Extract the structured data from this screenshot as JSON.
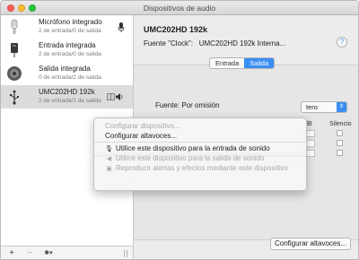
{
  "window": {
    "title": "Dispositivos de audio"
  },
  "sidebar": {
    "devices": [
      {
        "name": "Micrófono integrado",
        "sub": "2 de entrada/0 de salida",
        "icon": "microphone-icon"
      },
      {
        "name": "Entrada integrada",
        "sub": "2 de entrada/0 de salida",
        "icon": "audio-jack-icon"
      },
      {
        "name": "Salida integrada",
        "sub": "0 de entrada/2 de salida",
        "icon": "speaker-icon"
      },
      {
        "name": "UMC202HD 192k",
        "sub": "2 de entrada/2 de salida",
        "icon": "usb-icon"
      }
    ],
    "add_label": "+",
    "remove_label": "−",
    "action_label": "✱▾"
  },
  "main": {
    "device_title": "UMC202HD 192k",
    "source_label": "Fuente \"Clock\":",
    "source_value": "UMC202HD 192k Interna...",
    "help_label": "?",
    "tabs": [
      "Entrada",
      "Salida"
    ],
    "active_tab": "Salida",
    "focus_label": "Fuente:",
    "focus_value": "Por omisión",
    "select_value": "tero",
    "columns": [
      "dB",
      "Silencio"
    ],
    "rows": 3,
    "config_button": "Configurar altavoces..."
  },
  "context_menu": {
    "items": [
      {
        "label": "Configurar dispositivo...",
        "enabled": false
      },
      {
        "label": "Configurar altavoces...",
        "enabled": true
      },
      {
        "label": "Utilice este dispositivo para la entrada de sonido",
        "enabled": true,
        "icon": "microphone-icon"
      },
      {
        "label": "Utilice este dispositivo para la salida de sonido",
        "enabled": false,
        "icon": "speaker-icon"
      },
      {
        "label": "Reproducir alertas y efectos mediante este dispositivo",
        "enabled": false,
        "icon": "alert-icon"
      }
    ]
  },
  "colors": {
    "accent": "#3b8ef3",
    "selection": "#dcdcdc"
  }
}
